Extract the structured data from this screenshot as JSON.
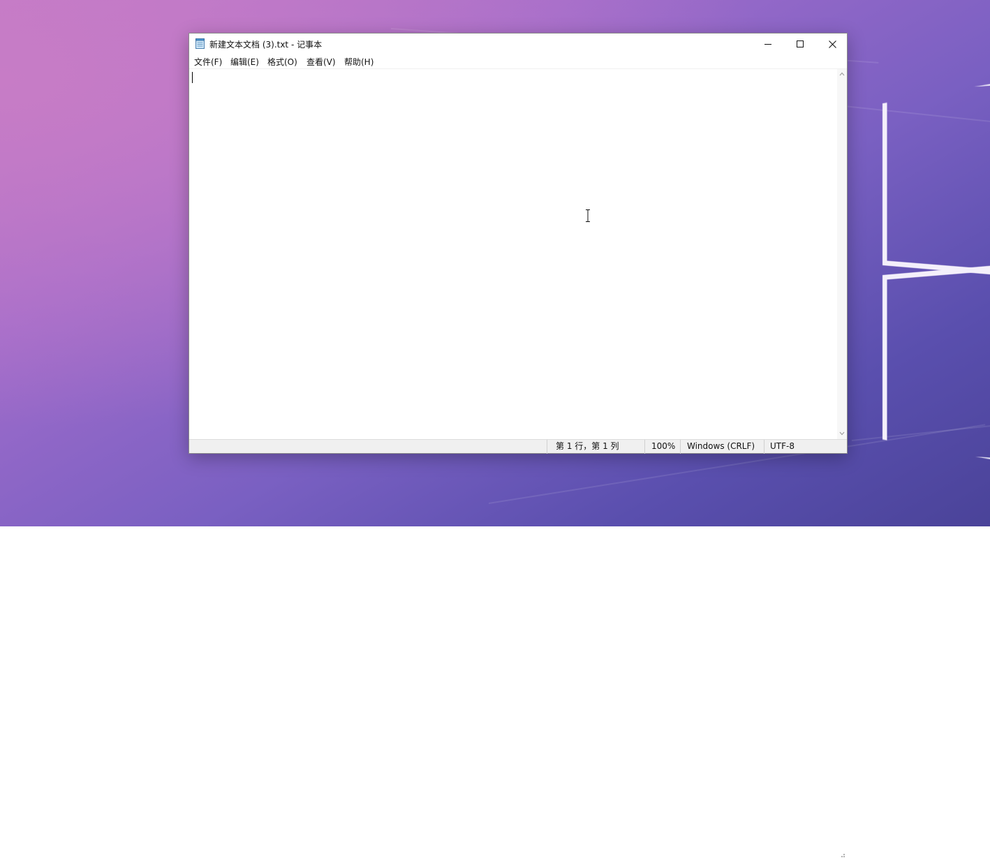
{
  "window": {
    "title": "新建文本文档 (3).txt - 记事本",
    "icon": "notepad-icon"
  },
  "caption_buttons": {
    "minimize_icon": "minimize-icon",
    "maximize_icon": "maximize-icon",
    "close_icon": "close-icon"
  },
  "menu": {
    "items": [
      {
        "label": "文件(F)"
      },
      {
        "label": "编辑(E)"
      },
      {
        "label": "格式(O)"
      },
      {
        "label": "查看(V)"
      },
      {
        "label": "帮助(H)"
      }
    ]
  },
  "editor": {
    "content": ""
  },
  "status_bar": {
    "position": "第 1 行，第 1 列",
    "zoom": "100%",
    "line_ending": "Windows (CRLF)",
    "encoding": "UTF-8"
  },
  "colors": {
    "desktop_start": "#c27ac9",
    "desktop_end": "#4a4399",
    "window_bg": "#ffffff",
    "status_bg": "#f0f0f0"
  }
}
